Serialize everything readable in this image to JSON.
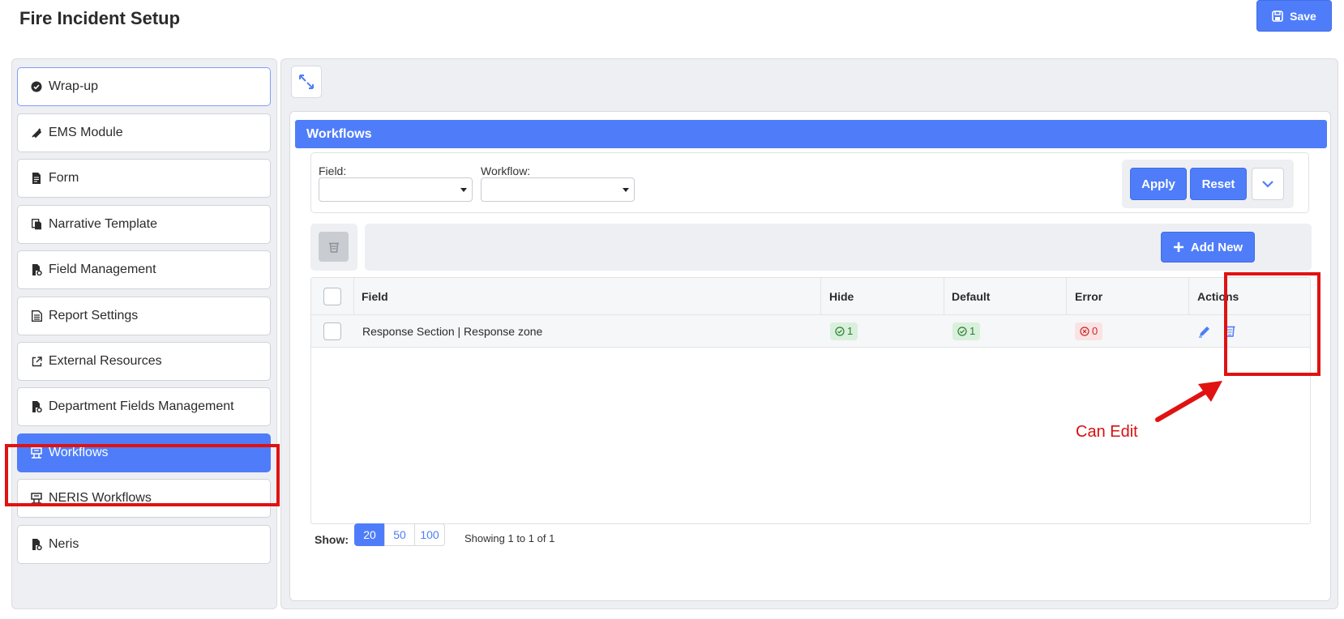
{
  "page": {
    "title": "Fire Incident Setup",
    "save_label": "Save"
  },
  "sidebar": {
    "items": [
      {
        "label": "Wrap-up",
        "icon": "check-circle-icon"
      },
      {
        "label": "EMS Module",
        "icon": "syringe-icon"
      },
      {
        "label": "Form",
        "icon": "document-icon"
      },
      {
        "label": "Narrative Template",
        "icon": "copy-document-icon"
      },
      {
        "label": "Field Management",
        "icon": "document-gear-icon"
      },
      {
        "label": "Report Settings",
        "icon": "report-icon"
      },
      {
        "label": "External Resources",
        "icon": "external-link-icon"
      },
      {
        "label": "Department Fields Management",
        "icon": "document-gear-icon"
      },
      {
        "label": "Workflows",
        "icon": "workflow-icon"
      },
      {
        "label": "NERIS Workflows",
        "icon": "workflow-icon"
      },
      {
        "label": "Neris",
        "icon": "document-gear-icon"
      }
    ],
    "selected": "Workflows"
  },
  "panel": {
    "title": "Workflows",
    "filters": {
      "field_label": "Field:",
      "workflow_label": "Workflow:",
      "apply_label": "Apply",
      "reset_label": "Reset"
    },
    "add_new_label": "Add New",
    "table": {
      "columns": [
        "Field",
        "Hide",
        "Default",
        "Error",
        "Actions"
      ],
      "rows": [
        {
          "field": "Response Section | Response zone",
          "hide": "1",
          "default": "1",
          "error": "0"
        }
      ]
    },
    "pagination": {
      "show_label": "Show:",
      "options": [
        "20",
        "50",
        "100"
      ],
      "selected": "20",
      "summary": "Showing 1 to 1 of 1"
    }
  },
  "annotation": {
    "text": "Can Edit",
    "color": "#d81010"
  },
  "colors": {
    "accent": "#4f7df9",
    "highlight": "#e01212"
  }
}
